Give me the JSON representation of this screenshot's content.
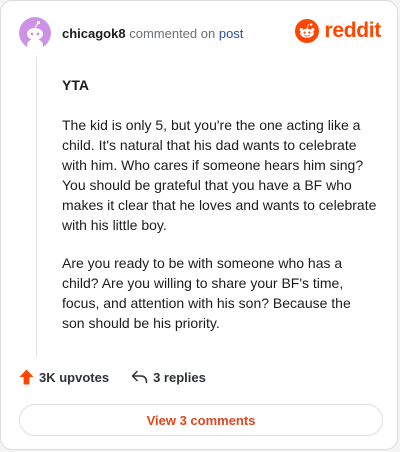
{
  "header": {
    "author": "chicagok8",
    "commented_text": "commented on",
    "post_link": "post",
    "brand_name": "reddit",
    "brand_color": "#ff4500",
    "avatar_color": "#cc92e6"
  },
  "comment": {
    "paragraphs": [
      "YTA",
      "The kid is only 5, but you're the one acting like a child. It's natural that his dad wants to celebrate with him. Who cares if someone hears him sing? You should be grateful that you have a BF who makes it clear that he loves and wants to celebrate with his little boy.",
      "Are you ready to be with someone who has a child? Are you willing to share your BF's time, focus, and attention with his son? Because the son should be his priority."
    ]
  },
  "actions": {
    "upvotes_label": "3K upvotes",
    "replies_label": "3 replies",
    "upvote_icon": "upvote-arrow-icon",
    "reply_icon": "reply-arrow-icon"
  },
  "footer": {
    "view_comments_label": "View 3 comments"
  }
}
